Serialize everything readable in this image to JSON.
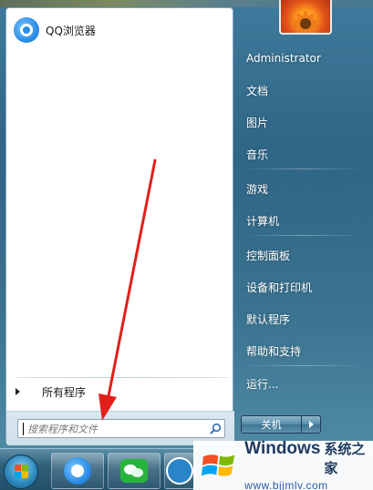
{
  "start_menu": {
    "pinned_app": {
      "label": "QQ浏览器",
      "icon": "qq-browser-icon"
    },
    "all_programs_label": "所有程序",
    "search": {
      "placeholder": "搜索程序和文件",
      "icon": "search-icon"
    }
  },
  "right_panel": {
    "user_name": "Administrator",
    "items": [
      {
        "label": "文档"
      },
      {
        "label": "图片"
      },
      {
        "label": "音乐"
      },
      {
        "label": "游戏"
      },
      {
        "label": "计算机"
      },
      {
        "label": "控制面板"
      },
      {
        "label": "设备和打印机"
      },
      {
        "label": "默认程序"
      },
      {
        "label": "帮助和支持"
      },
      {
        "label": "运行..."
      }
    ],
    "shutdown_label": "关机"
  },
  "taskbar": {
    "items": [
      "start-orb",
      "qq-browser-icon",
      "wechat-icon",
      "app-icon"
    ]
  },
  "watermark": {
    "brand": "Windows",
    "brand_cn": "系统之家",
    "url": "www.bjjmlv.com"
  },
  "colors": {
    "annotation_arrow": "#e0201b",
    "menu_left_bg": "#ffffff",
    "watermark_text": "#1f3a5e"
  }
}
